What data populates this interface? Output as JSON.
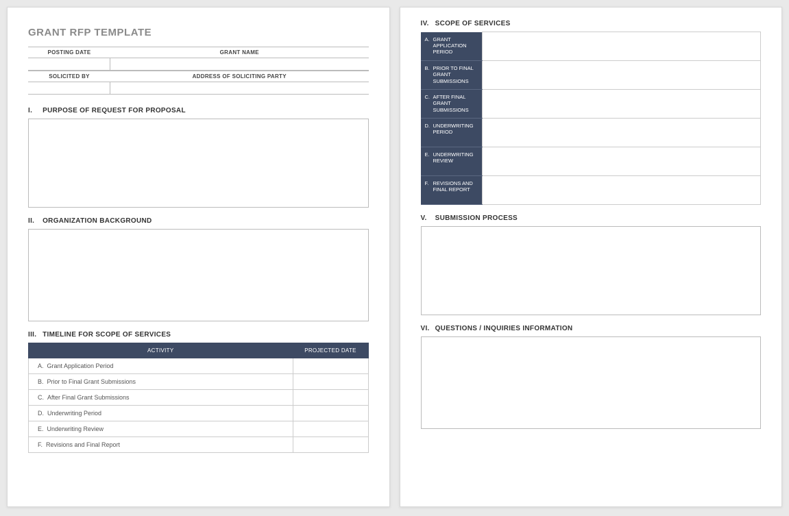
{
  "doc_title": "GRANT RFP TEMPLATE",
  "header": {
    "posting_date_label": "POSTING DATE",
    "grant_name_label": "GRANT NAME",
    "solicited_by_label": "SOLICITED BY",
    "address_label": "ADDRESS OF SOLICITING PARTY"
  },
  "sections": {
    "s1": {
      "num": "I.",
      "title": "PURPOSE OF REQUEST FOR PROPOSAL"
    },
    "s2": {
      "num": "II.",
      "title": "ORGANIZATION BACKGROUND"
    },
    "s3": {
      "num": "III.",
      "title": "TIMELINE FOR SCOPE OF SERVICES"
    },
    "s4": {
      "num": "IV.",
      "title": "SCOPE OF SERVICES"
    },
    "s5": {
      "num": "V.",
      "title": "SUBMISSION PROCESS"
    },
    "s6": {
      "num": "VI.",
      "title": "QUESTIONS / INQUIRIES INFORMATION"
    }
  },
  "timeline": {
    "col_activity": "ACTIVITY",
    "col_date": "PROJECTED DATE",
    "rows": [
      {
        "letter": "A.",
        "label": "Grant Application Period"
      },
      {
        "letter": "B.",
        "label": "Prior to Final Grant Submissions"
      },
      {
        "letter": "C.",
        "label": "After Final Grant Submissions"
      },
      {
        "letter": "D.",
        "label": "Underwriting Period"
      },
      {
        "letter": "E.",
        "label": "Underwriting Review"
      },
      {
        "letter": "F.",
        "label": "Revisions and Final Report"
      }
    ]
  },
  "scope_rows": [
    {
      "letter": "A.",
      "label": "GRANT APPLICATION PERIOD"
    },
    {
      "letter": "B.",
      "label": "PRIOR TO FINAL GRANT SUBMISSIONS"
    },
    {
      "letter": "C.",
      "label": "AFTER FINAL GRANT SUBMISSIONS"
    },
    {
      "letter": "D.",
      "label": "UNDERWRITING PERIOD"
    },
    {
      "letter": "E.",
      "label": "UNDERWRITING REVIEW"
    },
    {
      "letter": "F.",
      "label": "REVISIONS AND FINAL REPORT"
    }
  ]
}
